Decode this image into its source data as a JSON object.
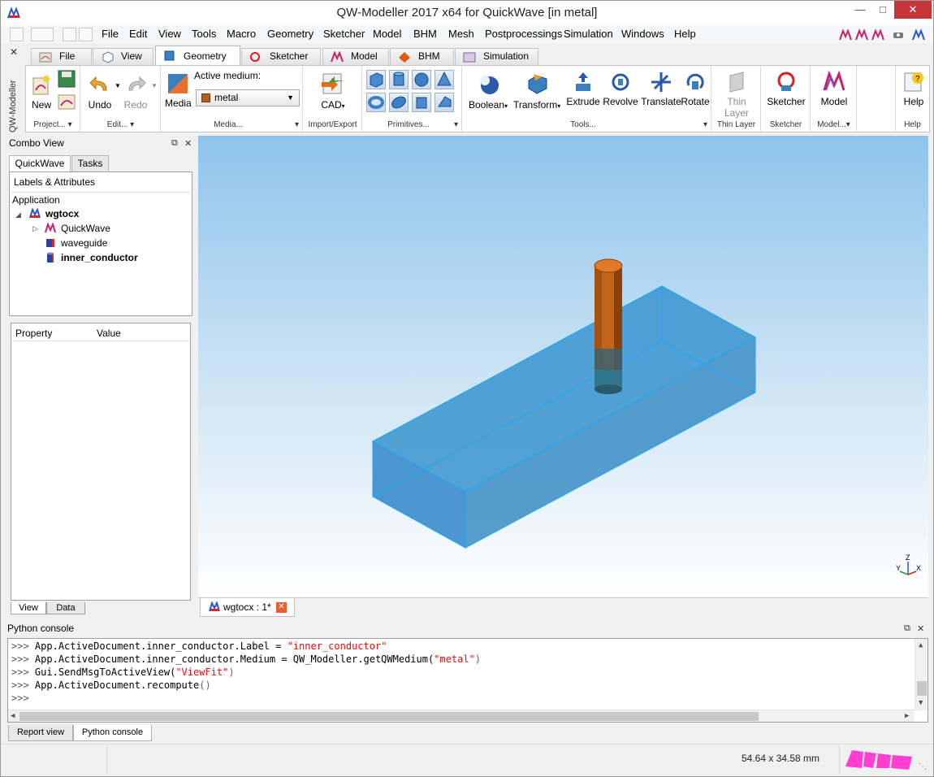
{
  "window": {
    "title": "QW-Modeller 2017 x64 for QuickWave [in metal]"
  },
  "menu": [
    "File",
    "Edit",
    "View",
    "Tools",
    "Macro",
    "Geometry",
    "Sketcher",
    "Model",
    "BHM",
    "Mesh",
    "Postprocessings",
    "Simulation",
    "Windows",
    "Help"
  ],
  "ribbon_tabs": [
    "File",
    "View",
    "Geometry",
    "Sketcher",
    "Model",
    "BHM",
    "Simulation"
  ],
  "active_ribbon_tab": "Geometry",
  "ribbon": {
    "side_label": "QW-Modeller",
    "project": {
      "new": "New",
      "label": "Project..."
    },
    "edit": {
      "undo": "Undo",
      "redo": "Redo",
      "label": "Edit..."
    },
    "media": {
      "button": "Media",
      "active_medium_label": "Active medium:",
      "active_medium_value": "metal",
      "label": "Media..."
    },
    "import_export": {
      "cad": "CAD",
      "label": "Import/Export"
    },
    "primitives": {
      "label": "Primitives..."
    },
    "tools": {
      "boolean": "Boolean",
      "transform": "Transform",
      "extrude": "Extrude",
      "revolve": "Revolve",
      "translate": "Translate",
      "rotate": "Rotate",
      "label": "Tools..."
    },
    "thin_layer": {
      "button": "Thin Layer",
      "label": "Thin Layer"
    },
    "sketcher": {
      "button": "Sketcher",
      "label": "Sketcher"
    },
    "model": {
      "button": "Model",
      "label": "Model..."
    },
    "help": {
      "button": "Help",
      "label": "Help"
    }
  },
  "combo_view": {
    "title": "Combo View",
    "tabs": [
      "QuickWave",
      "Tasks"
    ],
    "section": "Labels & Attributes",
    "root": "Application",
    "tree": [
      {
        "label": "wgtocx",
        "bold": true
      },
      {
        "label": "QuickWave",
        "bold": false
      },
      {
        "label": "waveguide",
        "bold": false
      },
      {
        "label": "inner_conductor",
        "bold": true
      }
    ],
    "property_headers": [
      "Property",
      "Value"
    ],
    "bottom_tabs": [
      "View",
      "Data"
    ]
  },
  "document_tab": {
    "label": "wgtocx : 1*"
  },
  "axis": {
    "z": "Z",
    "y": "Y",
    "x": "X"
  },
  "console": {
    "title": "Python console",
    "prompt": ">>>",
    "lines": [
      {
        "code": "App.ActiveDocument.inner_conductor.Label = ",
        "str": "\"inner_conductor\"",
        "tail": ""
      },
      {
        "code": "App.ActiveDocument.inner_conductor.Medium = QW_Modeller.getQWMedium(",
        "str": "\"metal\"",
        "tail": ")"
      },
      {
        "code": "Gui.SendMsgToActiveView(",
        "str": "\"ViewFit\"",
        "tail": ")"
      },
      {
        "code": "App.ActiveDocument.recompute",
        "str": "",
        "tail": "()"
      }
    ]
  },
  "bottom_tabs": [
    "Report view",
    "Python console"
  ],
  "status": {
    "size": "54.64 x 34.58 mm"
  },
  "colors": {
    "accent": "#3a7fc0",
    "close": "#c7343a",
    "waveguide": "#2a8ccf",
    "conductor": "#c0651a",
    "logo": "#ff3fd2"
  }
}
